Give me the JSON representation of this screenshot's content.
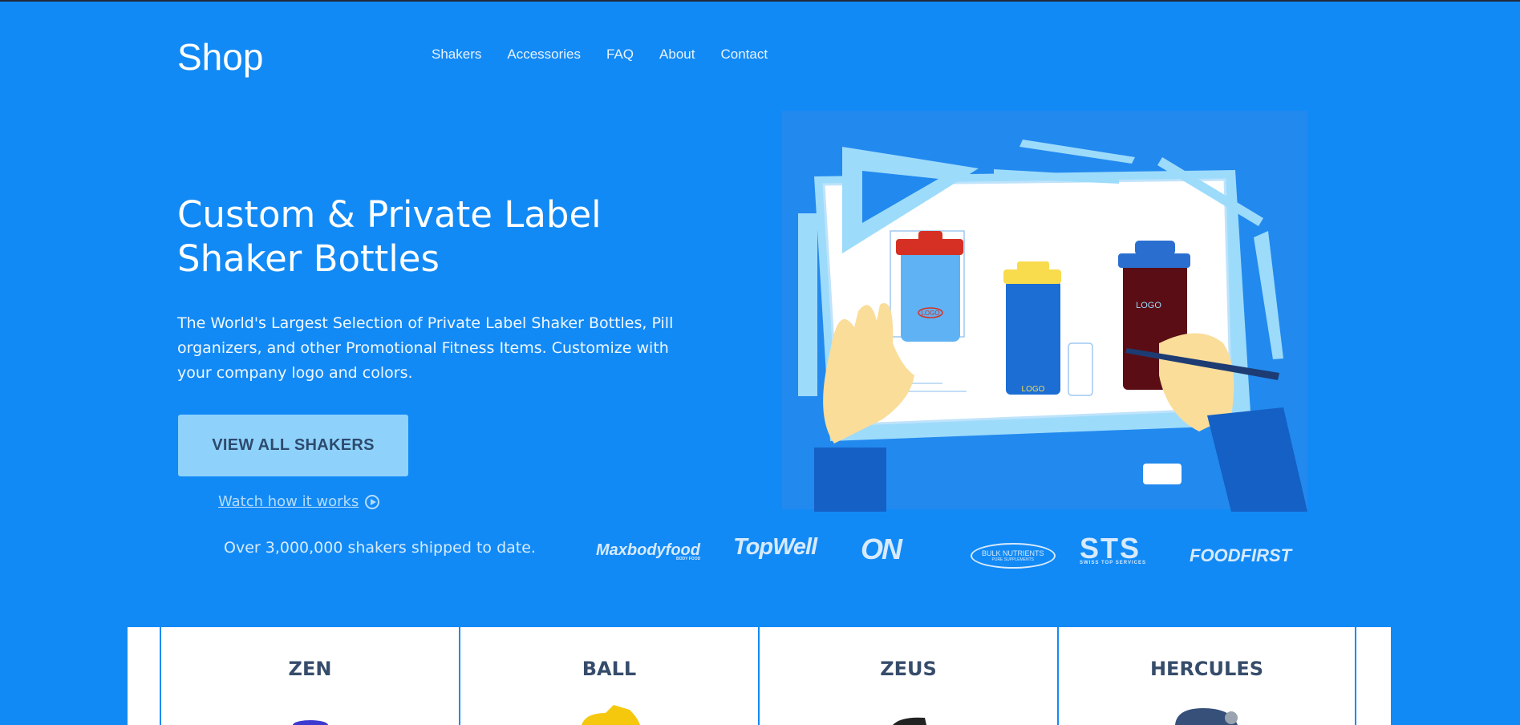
{
  "header": {
    "brand": "Shop",
    "nav": [
      "Shakers",
      "Accessories",
      "FAQ",
      "About",
      "Contact"
    ]
  },
  "hero": {
    "title": "Custom & Private Label Shaker Bottles",
    "description": "The World's Largest Selection of Private Label Shaker Bottles, Pill organizers, and other Promotional Fitness Items. Customize with your company logo and colors.",
    "cta_label": "VIEW ALL SHAKERS",
    "watch_label": "Watch how it works",
    "shipped_text": "Over 3,000,000 shakers shipped to date.",
    "illustration_labels": [
      "LOGO",
      "LOGO",
      "LOGO"
    ]
  },
  "client_logos": [
    "Maxbodyfood",
    "TopWell",
    "ON",
    "BULK NUTRIENTS",
    "STS",
    "FOODFIRST"
  ],
  "client_logo_sublines": [
    "BODY FOOD",
    "PURE SUPPLEMENTS",
    "SWISS TOP SERVICES"
  ],
  "products": [
    "ZEN",
    "BALL",
    "ZEUS",
    "HERCULES"
  ],
  "colors": {
    "background": "#128af5",
    "cta_bg": "#8ed2fb",
    "card_title": "#364c6b"
  }
}
